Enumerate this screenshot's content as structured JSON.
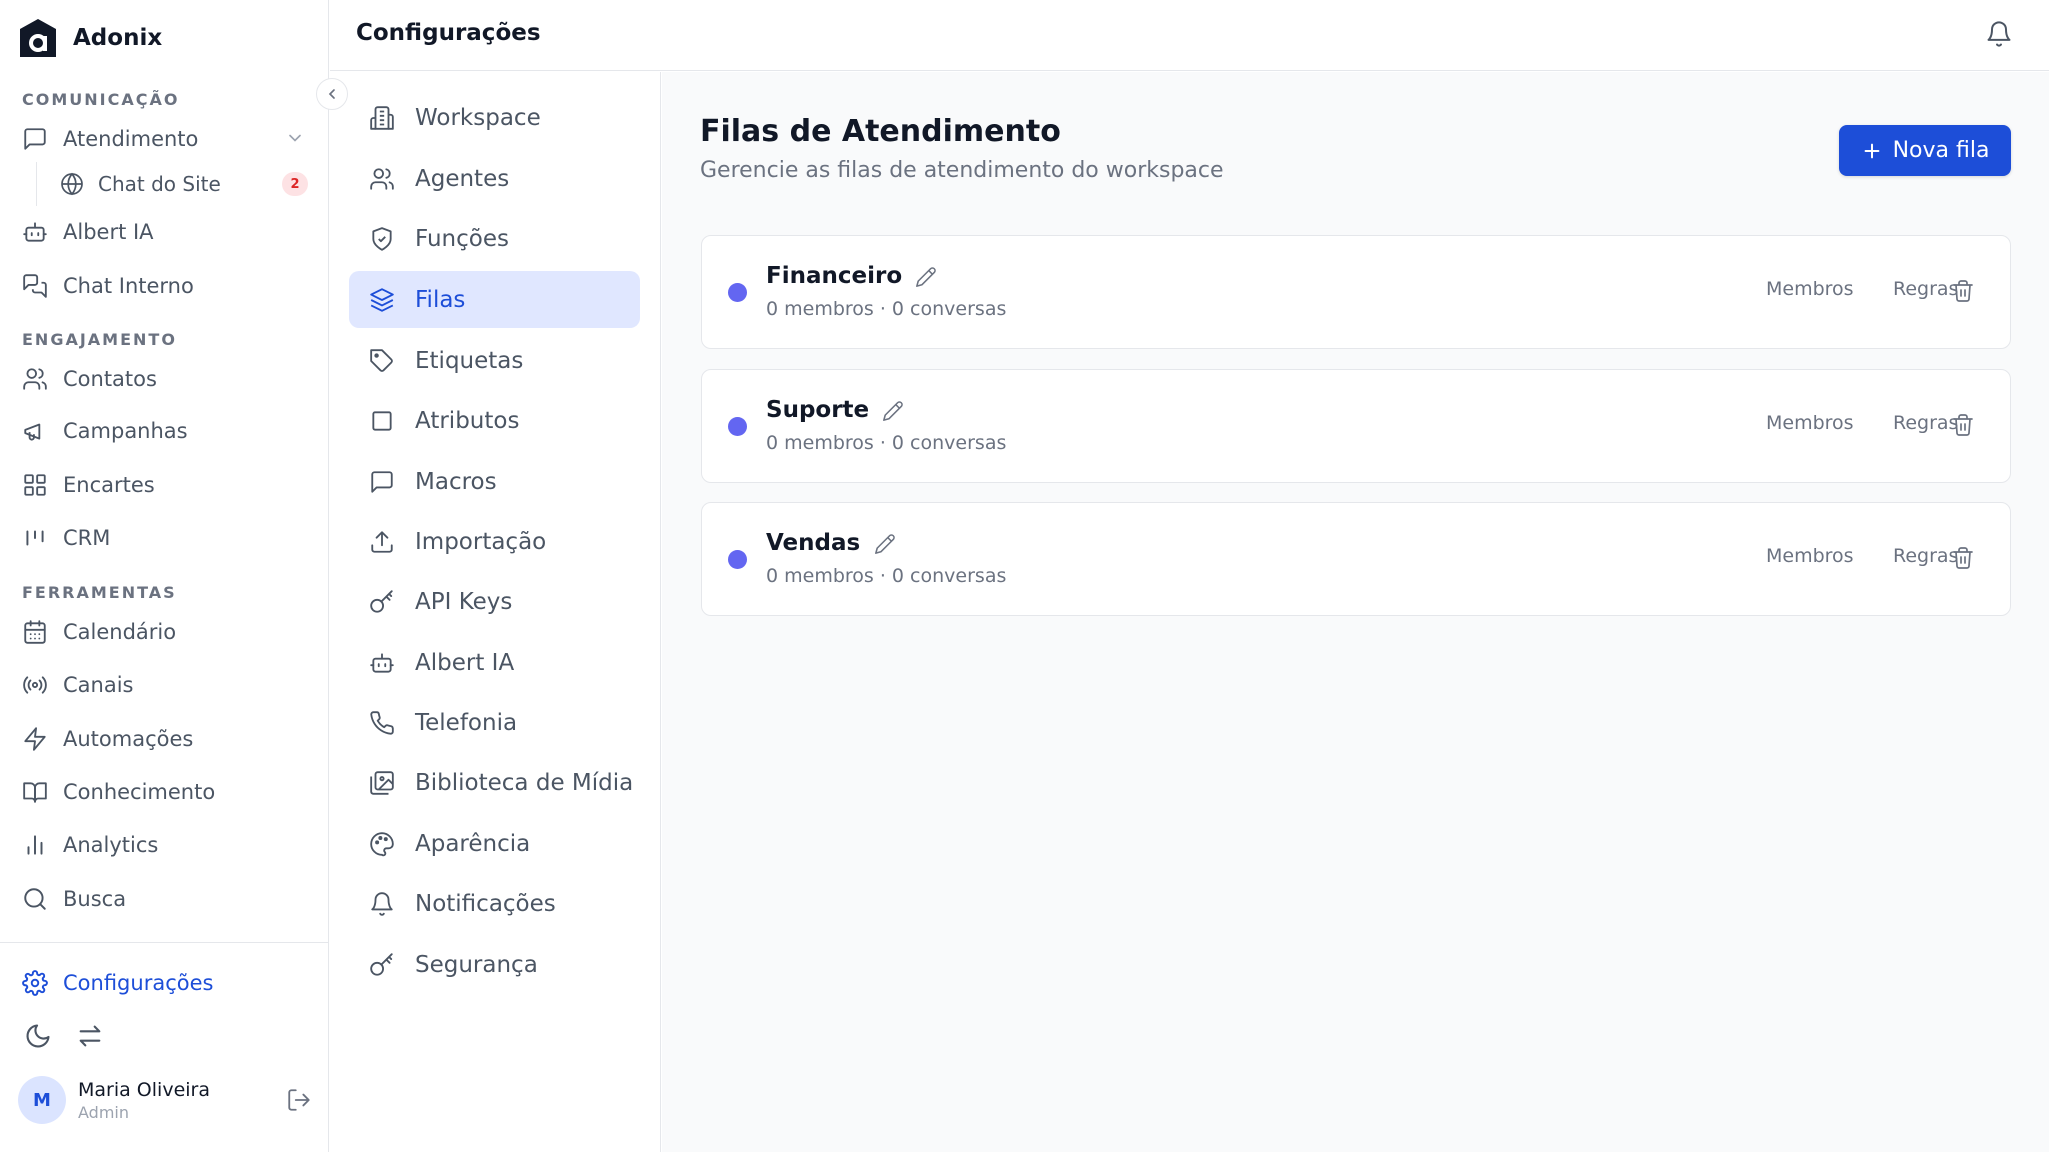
{
  "app": {
    "name": "Adonix"
  },
  "sidebar": {
    "sections": [
      {
        "label": "Comunicação"
      },
      {
        "label": "Engajamento"
      },
      {
        "label": "Ferramentas"
      }
    ],
    "items": {
      "atendimento": {
        "label": "Atendimento",
        "icon": "message-square-icon"
      },
      "chat_site": {
        "label": "Chat do Site",
        "icon": "globe-icon",
        "badge": "2"
      },
      "albert": {
        "label": "Albert IA",
        "icon": "bot-icon"
      },
      "chat_interno": {
        "label": "Chat Interno",
        "icon": "messages-icon"
      },
      "contatos": {
        "label": "Contatos",
        "icon": "users-icon"
      },
      "campanhas": {
        "label": "Campanhas",
        "icon": "megaphone-icon"
      },
      "encartes": {
        "label": "Encartes",
        "icon": "grid-icon"
      },
      "crm": {
        "label": "CRM",
        "icon": "kanban-icon"
      },
      "calendario": {
        "label": "Calendário",
        "icon": "calendar-icon"
      },
      "canais": {
        "label": "Canais",
        "icon": "radio-icon"
      },
      "automacoes": {
        "label": "Automações",
        "icon": "zap-icon"
      },
      "conhecimento": {
        "label": "Conhecimento",
        "icon": "book-icon"
      },
      "analytics": {
        "label": "Analytics",
        "icon": "bar-chart-icon"
      },
      "busca": {
        "label": "Busca",
        "icon": "search-icon"
      },
      "configuracoes": {
        "label": "Configurações",
        "icon": "gear-icon",
        "active": true
      }
    },
    "user": {
      "initial": "M",
      "name": "Maria Oliveira",
      "role": "Admin"
    }
  },
  "topbar": {
    "title": "Configurações"
  },
  "settings_nav": {
    "items": [
      {
        "label": "Workspace",
        "icon": "building-icon"
      },
      {
        "label": "Agentes",
        "icon": "users-icon"
      },
      {
        "label": "Funções",
        "icon": "shield-icon"
      },
      {
        "label": "Filas",
        "icon": "layers-icon",
        "active": true
      },
      {
        "label": "Etiquetas",
        "icon": "tag-icon"
      },
      {
        "label": "Atributos",
        "icon": "square-icon"
      },
      {
        "label": "Macros",
        "icon": "message-square-icon"
      },
      {
        "label": "Importação",
        "icon": "upload-icon"
      },
      {
        "label": "API Keys",
        "icon": "key-icon"
      },
      {
        "label": "Albert IA",
        "icon": "bot-icon"
      },
      {
        "label": "Telefonia",
        "icon": "phone-icon"
      },
      {
        "label": "Biblioteca de Mídia",
        "icon": "images-icon"
      },
      {
        "label": "Aparência",
        "icon": "palette-icon"
      },
      {
        "label": "Notificações",
        "icon": "bell-icon"
      },
      {
        "label": "Segurança",
        "icon": "key-icon"
      }
    ]
  },
  "main": {
    "title": "Filas de Atendimento",
    "subtitle": "Gerencie as filas de atendimento do workspace",
    "new_button": "Nova fila",
    "queues": [
      {
        "name": "Financeiro",
        "meta": "0 membros · 0 conversas",
        "members_label": "Membros",
        "rules_label": "Regras",
        "color": "#6366f1"
      },
      {
        "name": "Suporte",
        "meta": "0 membros · 0 conversas",
        "members_label": "Membros",
        "rules_label": "Regras",
        "color": "#6366f1"
      },
      {
        "name": "Vendas",
        "meta": "0 membros · 0 conversas",
        "members_label": "Membros",
        "rules_label": "Regras",
        "color": "#6366f1"
      }
    ]
  },
  "colors": {
    "accent": "#1d4ed8",
    "active_bg": "#e0e7ff",
    "queue_dot": "#6366f1",
    "badge_bg": "#fde2e4",
    "badge_text": "#dc2626"
  }
}
